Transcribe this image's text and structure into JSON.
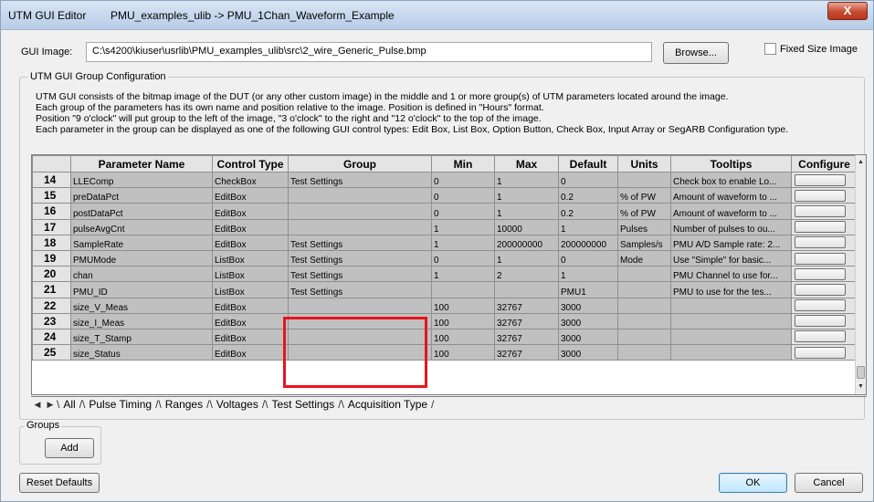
{
  "window": {
    "app_title": "UTM GUI Editor",
    "document_title": "PMU_examples_ulib  ->  PMU_1Chan_Waveform_Example",
    "close_glyph": "X"
  },
  "gui_image": {
    "label": "GUI Image:",
    "path": "C:\\s4200\\kiuser\\usrlib\\PMU_examples_ulib\\src\\2_wire_Generic_Pulse.bmp",
    "browse_label": "Browse...",
    "fixed_size_label": "Fixed Size Image",
    "fixed_size_checked": false
  },
  "group_config": {
    "title": "UTM GUI Group Configuration",
    "description": [
      "UTM GUI consists of the bitmap image of the DUT (or any other custom image) in the middle and 1 or more group(s) of UTM parameters located around the image.",
      "Each group of the parameters has its own name and position relative to the image. Position is defined in \"Hours\" format.",
      "Position \"9 o'clock\" will put group to the left of the image, \"3 o'clock\" to the right and \"12 o'clock\" to the top of the image.",
      "Each parameter in the group can be displayed as one of the following GUI control types: Edit Box, List Box, Option Button, Check Box, Input Array or SegARB Configuration type."
    ]
  },
  "table": {
    "columns": [
      "",
      "Parameter Name",
      "Control Type",
      "Group",
      "Min",
      "Max",
      "Default",
      "Units",
      "Tooltips",
      "Configure"
    ],
    "rows": [
      {
        "num": "14",
        "name": "LLEComp",
        "control": "CheckBox",
        "group": "Test Settings",
        "min": "0",
        "max": "1",
        "default": "0",
        "units": "",
        "tooltip": "Check box to enable Lo..."
      },
      {
        "num": "15",
        "name": "preDataPct",
        "control": "EditBox",
        "group": "",
        "min": "0",
        "max": "1",
        "default": "0.2",
        "units": "% of PW",
        "tooltip": "Amount of waveform to ..."
      },
      {
        "num": "16",
        "name": "postDataPct",
        "control": "EditBox",
        "group": "",
        "min": "0",
        "max": "1",
        "default": "0.2",
        "units": "% of PW",
        "tooltip": "Amount of waveform to ..."
      },
      {
        "num": "17",
        "name": "pulseAvgCnt",
        "control": "EditBox",
        "group": "",
        "min": "1",
        "max": "10000",
        "default": "1",
        "units": "Pulses",
        "tooltip": "Number of pulses to ou..."
      },
      {
        "num": "18",
        "name": "SampleRate",
        "control": "EditBox",
        "group": "Test Settings",
        "min": "1",
        "max": "200000000",
        "default": "200000000",
        "units": "Samples/s",
        "tooltip": "PMU A/D Sample rate: 2..."
      },
      {
        "num": "19",
        "name": "PMUMode",
        "control": "ListBox",
        "group": "Test Settings",
        "min": "0",
        "max": "1",
        "default": "0",
        "units": "Mode",
        "tooltip": "Use \"Simple\" for basic..."
      },
      {
        "num": "20",
        "name": "chan",
        "control": "ListBox",
        "group": "Test Settings",
        "min": "1",
        "max": "2",
        "default": "1",
        "units": "",
        "tooltip": "PMU Channel to use for..."
      },
      {
        "num": "21",
        "name": "PMU_ID",
        "control": "ListBox",
        "group": "Test Settings",
        "min": "",
        "max": "",
        "default": "PMU1",
        "units": "",
        "tooltip": "PMU to use for the tes..."
      },
      {
        "num": "22",
        "name": "size_V_Meas",
        "control": "EditBox",
        "group": "",
        "min": "100",
        "max": "32767",
        "default": "3000",
        "units": "",
        "tooltip": ""
      },
      {
        "num": "23",
        "name": "size_I_Meas",
        "control": "EditBox",
        "group": "",
        "min": "100",
        "max": "32767",
        "default": "3000",
        "units": "",
        "tooltip": ""
      },
      {
        "num": "24",
        "name": "size_T_Stamp",
        "control": "EditBox",
        "group": "",
        "min": "100",
        "max": "32767",
        "default": "3000",
        "units": "",
        "tooltip": ""
      },
      {
        "num": "25",
        "name": "size_Status",
        "control": "EditBox",
        "group": "",
        "min": "100",
        "max": "32767",
        "default": "3000",
        "units": "",
        "tooltip": ""
      }
    ]
  },
  "tabs": [
    "All",
    "Pulse Timing",
    "Ranges",
    "Voltages",
    "Test Settings",
    "Acquisition Type"
  ],
  "groups": {
    "title": "Groups",
    "add_label": "Add"
  },
  "buttons": {
    "reset": "Reset Defaults",
    "ok": "OK",
    "cancel": "Cancel"
  },
  "colors": {
    "highlight": "#e8141c",
    "cell_bg": "#c0c0c0"
  }
}
